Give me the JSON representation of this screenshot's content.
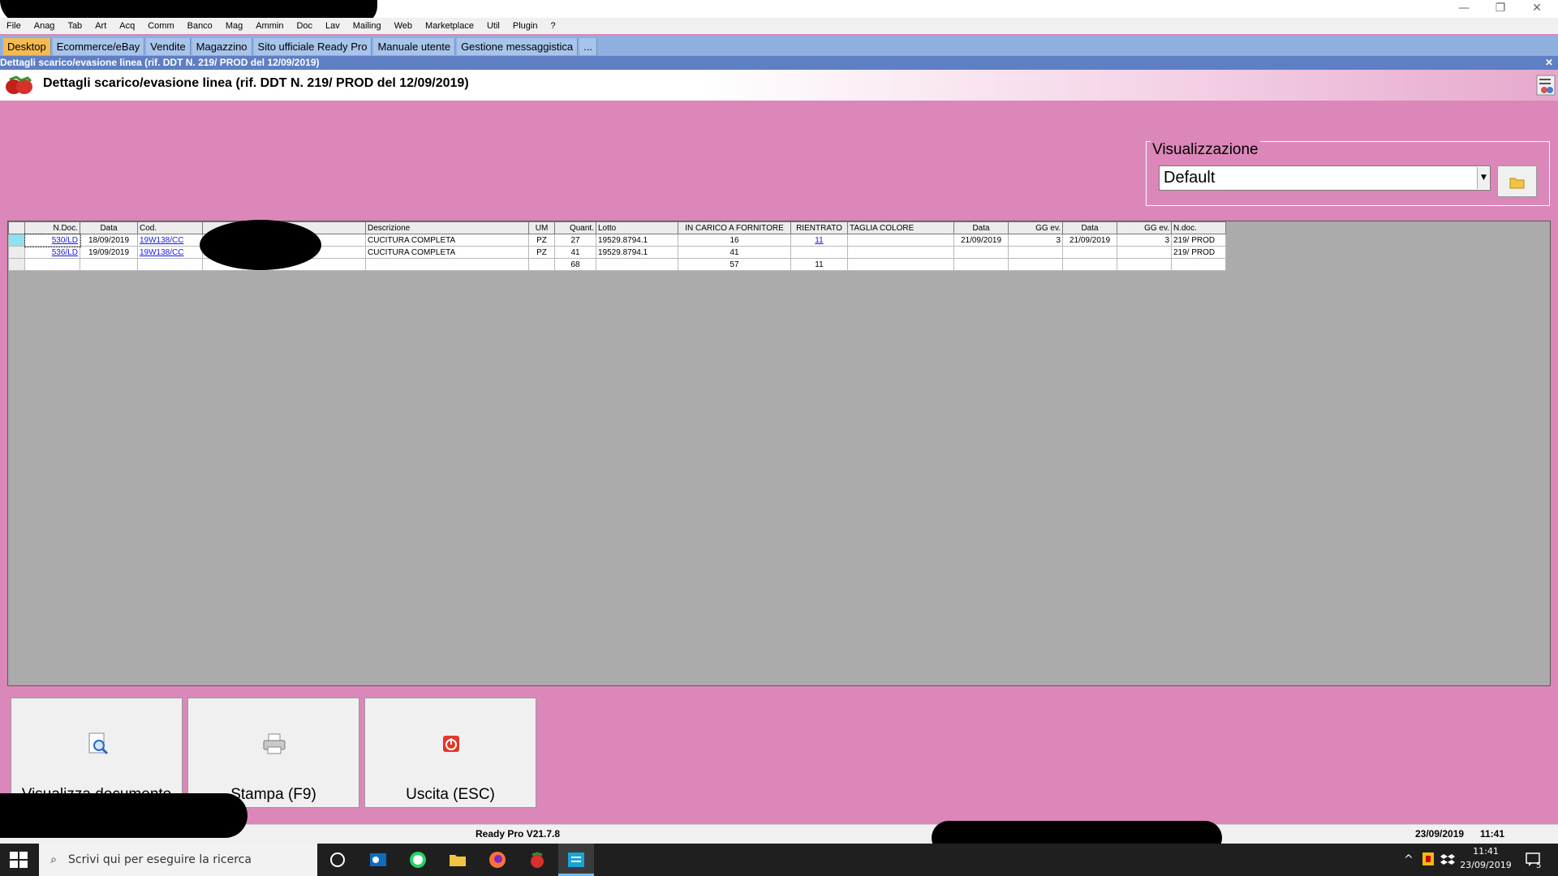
{
  "window": {
    "controls": [
      "—",
      "❐",
      "✕"
    ]
  },
  "menu": [
    "File",
    "Anag",
    "Tab",
    "Art",
    "Acq",
    "Comm",
    "Banco",
    "Mag",
    "Ammin",
    "Doc",
    "Lav",
    "Mailing",
    "Web",
    "Marketplace",
    "Util",
    "Plugin",
    "?"
  ],
  "tabs": [
    "Desktop",
    "Ecommerce/eBay",
    "Vendite",
    "Magazzino",
    "Sito ufficiale Ready Pro",
    "Manuale utente",
    "Gestione messaggistica",
    "..."
  ],
  "doc_strip": {
    "title": "Dettagli scarico/evasione linea (rif. DDT N. 219/ PROD del 12/09/2019)",
    "close": "✕"
  },
  "header": {
    "title": "Dettagli scarico/evasione linea (rif. DDT N. 219/ PROD del 12/09/2019)"
  },
  "visualizzazione": {
    "label": "Visualizzazione",
    "selected": "Default"
  },
  "grid": {
    "columns": [
      "",
      "N.Doc.",
      "Data",
      "Cod.",
      "",
      "Descrizione",
      "UM",
      "Quant.",
      "Lotto",
      "IN CARICO A FORNITORE",
      "RIENTRATO",
      "TAGLIA COLORE",
      "Data",
      "GG ev.",
      "Data",
      "GG ev.",
      "N.doc."
    ],
    "rows": [
      [
        "",
        "530/LD",
        "18/09/2019",
        "19W138/CC",
        "",
        "CUCITURA COMPLETA",
        "PZ",
        "27",
        "19529.8794.1",
        "16",
        "11",
        "",
        "21/09/2019",
        "3",
        "21/09/2019",
        "3",
        "219/ PROD"
      ],
      [
        "",
        "536/LD",
        "19/09/2019",
        "19W138/CC",
        "",
        "CUCITURA COMPLETA",
        "PZ",
        "41",
        "19529.8794.1",
        "41",
        "",
        "",
        "",
        "",
        "",
        "",
        "219/ PROD"
      ],
      [
        "",
        "",
        "",
        "",
        "",
        "",
        "",
        "68",
        "",
        "57",
        "11",
        "",
        "",
        "",
        "",
        "",
        ""
      ]
    ]
  },
  "buttons": {
    "view": "Visualizza documento",
    "print": "Stampa (F9)",
    "exit": "Uscita (ESC)"
  },
  "statusbar": {
    "version": "Ready Pro V21.7.8",
    "date": "23/09/2019",
    "time": "11:41"
  },
  "taskbar": {
    "search_placeholder": "Scrivi qui per eseguire la ricerca",
    "clock_time": "11:41",
    "clock_date": "23/09/2019",
    "notif_count": "5"
  }
}
